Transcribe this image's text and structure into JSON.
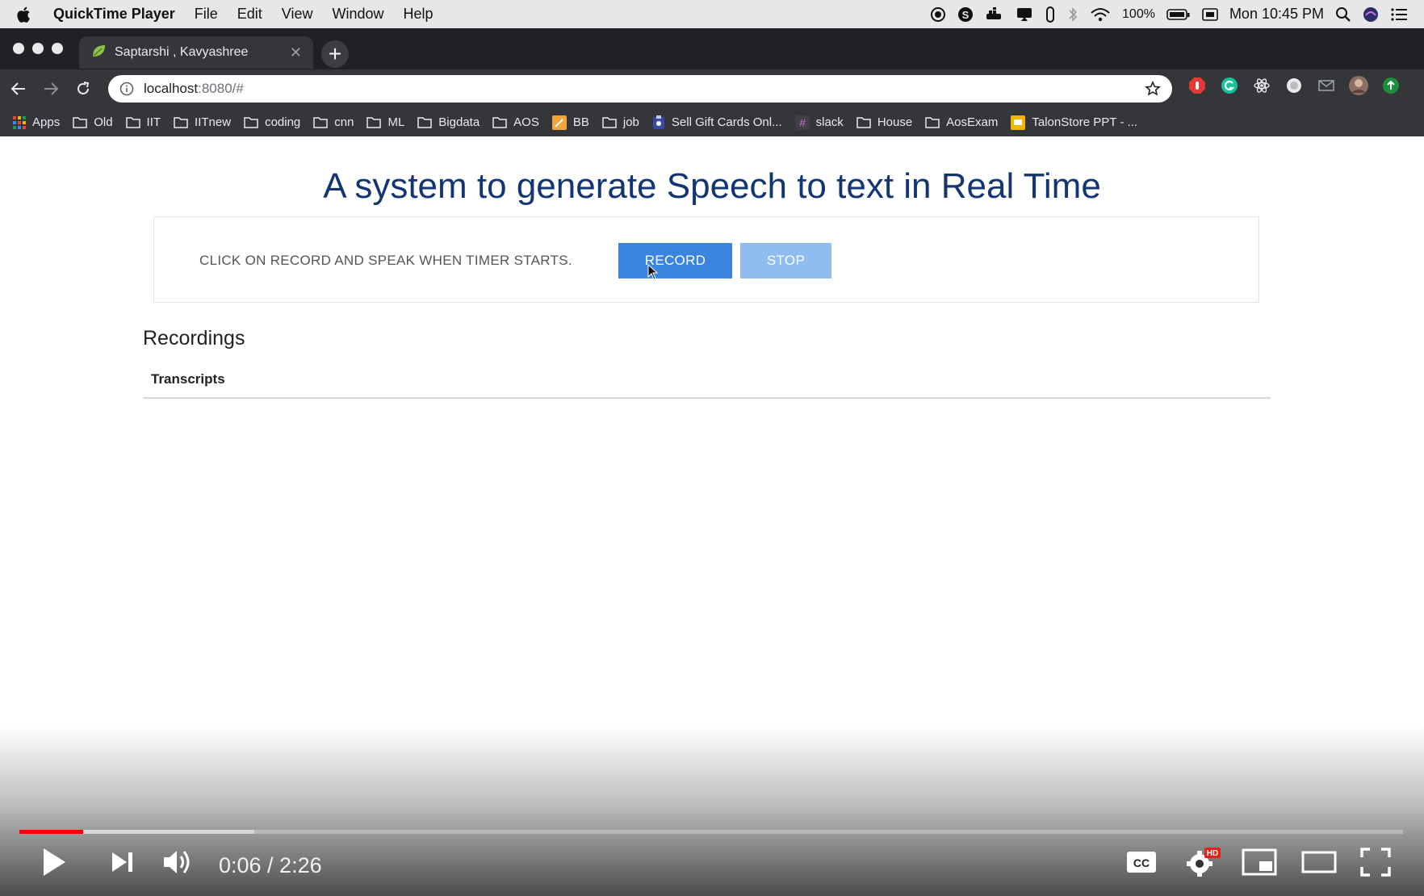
{
  "menubar": {
    "app_name": "QuickTime Player",
    "items": [
      "File",
      "Edit",
      "View",
      "Window",
      "Help"
    ],
    "battery": "100%",
    "clock": "Mon 10:45 PM"
  },
  "browser": {
    "tab_title": "Saptarshi , Kavyashree",
    "url_host": "localhost",
    "url_path": ":8080/#",
    "bookmarks": [
      "Apps",
      "Old",
      "IIT",
      "IITnew",
      "coding",
      "cnn",
      "ML",
      "Bigdata",
      "AOS",
      "BB",
      "job",
      "Sell Gift Cards Onl...",
      "slack",
      "House",
      "AosExam",
      "TalonStore PPT - ..."
    ]
  },
  "page": {
    "title": "A system to generate Speech to text in Real Time",
    "instruction": "CLICK ON RECORD AND SPEAK WHEN TIMER STARTS.",
    "record_label": "RECORD",
    "stop_label": "STOP",
    "recordings_heading": "Recordings",
    "transcripts_header": "Transcripts"
  },
  "player": {
    "time": "0:06 / 2:26",
    "progress_played": 0.046,
    "progress_buffered": 0.17,
    "accent": "#ff0000"
  }
}
